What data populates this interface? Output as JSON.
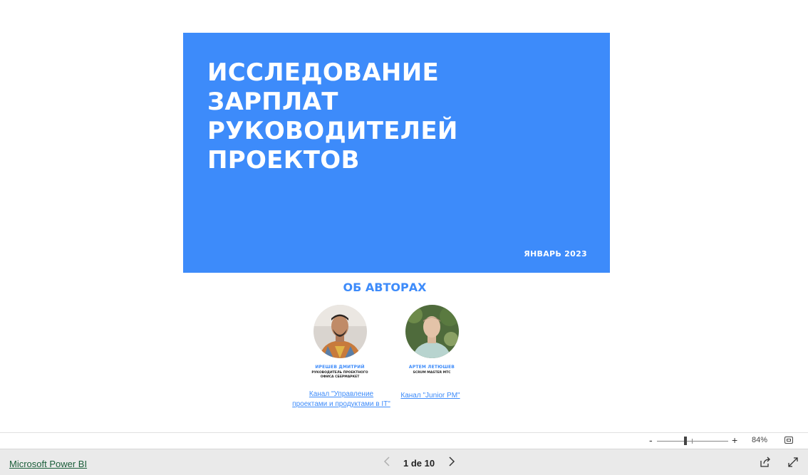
{
  "report": {
    "title_lines": [
      "ИССЛЕДОВАНИЕ",
      "ЗАРПЛАТ",
      "РУКОВОДИТЕЛЕЙ",
      "ПРОЕКТОВ"
    ],
    "date": "ЯНВАРЬ 2023",
    "about_heading": "ОБ АВТОРАХ",
    "authors": [
      {
        "name": "ИРЕШЕВ ДМИТРИЙ",
        "role": "РУКОВОДИТЕЛЬ ПРОЕКТНОГО ОФИСА СБЕРМАРКЕТ",
        "link": "Канал \"Управление проектами и продуктами в IT\""
      },
      {
        "name": "АРТЕМ ЛЕТЮШЕВ",
        "role": "SCRUM MASTER МТС",
        "link": "Канал \"Junior PM\""
      }
    ],
    "accent_color": "#3d8bfa"
  },
  "zoom": {
    "minus": "-",
    "plus": "+",
    "percent": "84%",
    "level_fraction": 0.4
  },
  "footer": {
    "brand_link": "Microsoft Power BI",
    "page_current": "1",
    "page_sep": "de",
    "page_total": "10",
    "prev_icon": "chevron-left-icon",
    "next_icon": "chevron-right-icon"
  }
}
